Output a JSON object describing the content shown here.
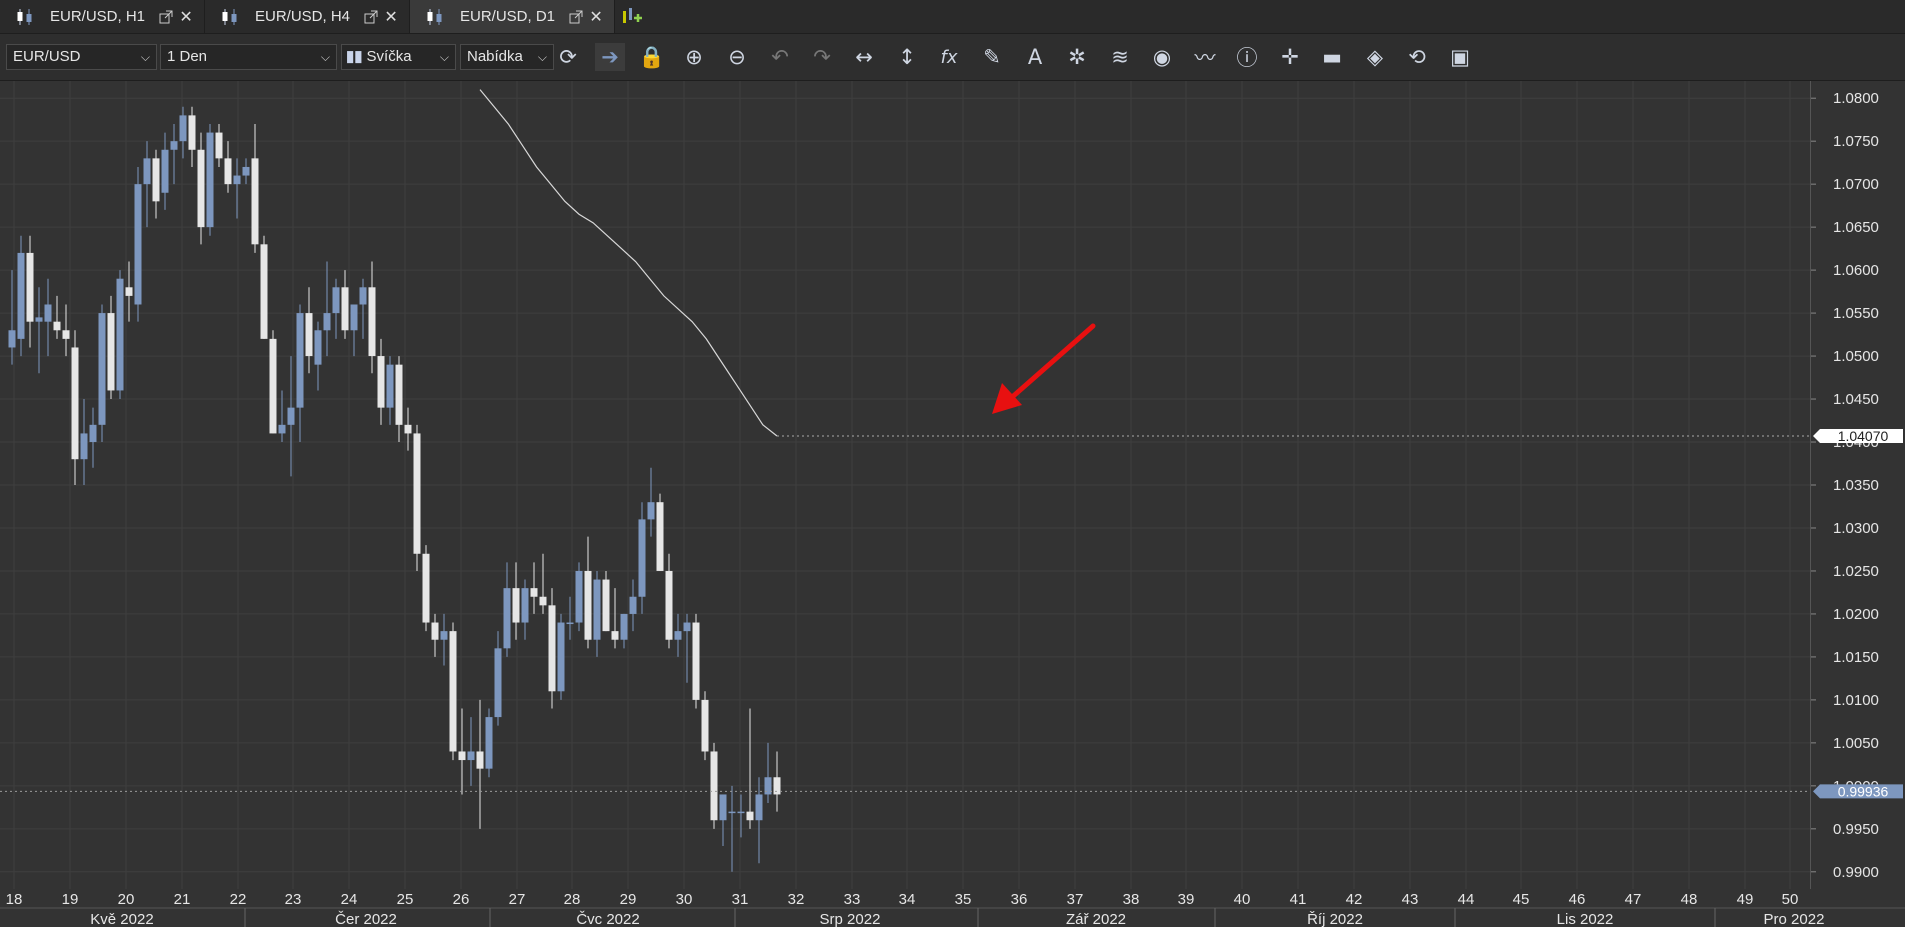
{
  "tabs": [
    {
      "label": "EUR/USD, H1",
      "icon": "candles-icon"
    },
    {
      "label": "EUR/USD, H4",
      "icon": "candles-icon"
    },
    {
      "label": "EUR/USD, D1",
      "icon": "candles-icon",
      "active": true
    }
  ],
  "toolbar": {
    "symbol": "EUR/USD",
    "period": "1 Den",
    "chart_type": "Svíčka",
    "price_type": "Nabídka",
    "icons": [
      "refresh-icon",
      "autoscroll-icon",
      "lock-icon",
      "zoom-in-icon",
      "zoom-out-icon",
      "undo-icon",
      "redo-icon",
      "horizontal-scale-icon",
      "vertical-scale-icon",
      "indicator-fx-icon",
      "pencil-icon",
      "text-tool-icon",
      "objects-icon",
      "layers-icon",
      "eye-icon",
      "signal-icon",
      "info-icon",
      "crosshair-icon",
      "ohlc-color-icon",
      "theme-icon",
      "settings-icon",
      "save-icon"
    ]
  },
  "colors": {
    "background": "#333333",
    "bull": "#7d97bf",
    "bear": "#e6e6e6",
    "grid": "#3f3f3f",
    "arrow": "#e81010",
    "current_price_tag": "#7d97bf"
  },
  "chart_data": {
    "type": "candlestick",
    "ylim": [
      0.988,
      1.082
    ],
    "yticks": [
      "1.0800",
      "1.0750",
      "1.0700",
      "1.0650",
      "1.0600",
      "1.0550",
      "1.0500",
      "1.0450",
      "1.0400",
      "1.0350",
      "1.0300",
      "1.0250",
      "1.0200",
      "1.0150",
      "1.0100",
      "1.0050",
      "1.0000",
      "0.9950",
      "0.9900"
    ],
    "week_labels": [
      "18",
      "19",
      "20",
      "21",
      "22",
      "23",
      "24",
      "25",
      "26",
      "27",
      "28",
      "29",
      "30",
      "31",
      "32",
      "33",
      "34",
      "35",
      "36",
      "37",
      "38",
      "39",
      "40",
      "41",
      "42",
      "43",
      "44",
      "45",
      "46",
      "47",
      "48",
      "49",
      "50"
    ],
    "month_labels": [
      "Kvě 2022",
      "Čer 2022",
      "Čvc 2022",
      "Srp 2022",
      "Zář 2022",
      "Říj 2022",
      "Lis 2022",
      "Pro 2022"
    ],
    "grid": true,
    "indicator_line": {
      "end_value": 1.0407,
      "label": "1.04070",
      "values": [
        1.081,
        1.079,
        1.077,
        1.0745,
        1.072,
        1.07,
        1.068,
        1.0665,
        1.0655,
        1.064,
        1.0625,
        1.061,
        1.059,
        1.057,
        1.0555,
        1.054,
        1.052,
        1.0495,
        1.047,
        1.0445,
        1.042,
        1.0407
      ]
    },
    "current_price": {
      "value": 0.99936,
      "label": "0.99936"
    },
    "candles": [
      {
        "o": 1.051,
        "h": 1.06,
        "l": 1.049,
        "c": 1.053
      },
      {
        "o": 1.052,
        "h": 1.064,
        "l": 1.05,
        "c": 1.062
      },
      {
        "o": 1.062,
        "h": 1.064,
        "l": 1.051,
        "c": 1.054
      },
      {
        "o": 1.054,
        "h": 1.058,
        "l": 1.048,
        "c": 1.0545
      },
      {
        "o": 1.054,
        "h": 1.059,
        "l": 1.05,
        "c": 1.056
      },
      {
        "o": 1.054,
        "h": 1.057,
        "l": 1.052,
        "c": 1.053
      },
      {
        "o": 1.053,
        "h": 1.056,
        "l": 1.05,
        "c": 1.052
      },
      {
        "o": 1.051,
        "h": 1.053,
        "l": 1.035,
        "c": 1.038
      },
      {
        "o": 1.038,
        "h": 1.045,
        "l": 1.035,
        "c": 1.041
      },
      {
        "o": 1.04,
        "h": 1.044,
        "l": 1.037,
        "c": 1.042
      },
      {
        "o": 1.042,
        "h": 1.056,
        "l": 1.04,
        "c": 1.055
      },
      {
        "o": 1.055,
        "h": 1.057,
        "l": 1.045,
        "c": 1.046
      },
      {
        "o": 1.046,
        "h": 1.06,
        "l": 1.045,
        "c": 1.059
      },
      {
        "o": 1.058,
        "h": 1.061,
        "l": 1.054,
        "c": 1.057
      },
      {
        "o": 1.056,
        "h": 1.072,
        "l": 1.054,
        "c": 1.07
      },
      {
        "o": 1.07,
        "h": 1.075,
        "l": 1.065,
        "c": 1.073
      },
      {
        "o": 1.073,
        "h": 1.074,
        "l": 1.066,
        "c": 1.068
      },
      {
        "o": 1.069,
        "h": 1.076,
        "l": 1.067,
        "c": 1.074
      },
      {
        "o": 1.074,
        "h": 1.077,
        "l": 1.07,
        "c": 1.075
      },
      {
        "o": 1.075,
        "h": 1.079,
        "l": 1.073,
        "c": 1.078
      },
      {
        "o": 1.078,
        "h": 1.079,
        "l": 1.072,
        "c": 1.074
      },
      {
        "o": 1.074,
        "h": 1.076,
        "l": 1.063,
        "c": 1.065
      },
      {
        "o": 1.065,
        "h": 1.077,
        "l": 1.064,
        "c": 1.076
      },
      {
        "o": 1.076,
        "h": 1.077,
        "l": 1.072,
        "c": 1.073
      },
      {
        "o": 1.073,
        "h": 1.075,
        "l": 1.069,
        "c": 1.07
      },
      {
        "o": 1.07,
        "h": 1.073,
        "l": 1.066,
        "c": 1.071
      },
      {
        "o": 1.071,
        "h": 1.073,
        "l": 1.07,
        "c": 1.072
      },
      {
        "o": 1.073,
        "h": 1.077,
        "l": 1.062,
        "c": 1.063
      },
      {
        "o": 1.063,
        "h": 1.064,
        "l": 1.052,
        "c": 1.052
      },
      {
        "o": 1.052,
        "h": 1.053,
        "l": 1.041,
        "c": 1.041
      },
      {
        "o": 1.041,
        "h": 1.046,
        "l": 1.04,
        "c": 1.042
      },
      {
        "o": 1.042,
        "h": 1.05,
        "l": 1.036,
        "c": 1.044
      },
      {
        "o": 1.044,
        "h": 1.056,
        "l": 1.04,
        "c": 1.055
      },
      {
        "o": 1.055,
        "h": 1.058,
        "l": 1.048,
        "c": 1.05
      },
      {
        "o": 1.049,
        "h": 1.054,
        "l": 1.046,
        "c": 1.053
      },
      {
        "o": 1.053,
        "h": 1.061,
        "l": 1.05,
        "c": 1.055
      },
      {
        "o": 1.055,
        "h": 1.059,
        "l": 1.052,
        "c": 1.058
      },
      {
        "o": 1.058,
        "h": 1.06,
        "l": 1.052,
        "c": 1.053
      },
      {
        "o": 1.053,
        "h": 1.056,
        "l": 1.05,
        "c": 1.056
      },
      {
        "o": 1.056,
        "h": 1.059,
        "l": 1.052,
        "c": 1.058
      },
      {
        "o": 1.058,
        "h": 1.061,
        "l": 1.048,
        "c": 1.05
      },
      {
        "o": 1.05,
        "h": 1.052,
        "l": 1.042,
        "c": 1.044
      },
      {
        "o": 1.044,
        "h": 1.05,
        "l": 1.042,
        "c": 1.049
      },
      {
        "o": 1.049,
        "h": 1.05,
        "l": 1.04,
        "c": 1.042
      },
      {
        "o": 1.042,
        "h": 1.044,
        "l": 1.039,
        "c": 1.041
      },
      {
        "o": 1.041,
        "h": 1.042,
        "l": 1.025,
        "c": 1.027
      },
      {
        "o": 1.027,
        "h": 1.028,
        "l": 1.018,
        "c": 1.019
      },
      {
        "o": 1.019,
        "h": 1.02,
        "l": 1.015,
        "c": 1.017
      },
      {
        "o": 1.017,
        "h": 1.02,
        "l": 1.014,
        "c": 1.018
      },
      {
        "o": 1.018,
        "h": 1.019,
        "l": 1.003,
        "c": 1.004
      },
      {
        "o": 1.004,
        "h": 1.009,
        "l": 0.999,
        "c": 1.003
      },
      {
        "o": 1.003,
        "h": 1.008,
        "l": 1.0,
        "c": 1.004
      },
      {
        "o": 1.004,
        "h": 1.01,
        "l": 0.995,
        "c": 1.002
      },
      {
        "o": 1.002,
        "h": 1.009,
        "l": 1.001,
        "c": 1.008
      },
      {
        "o": 1.008,
        "h": 1.018,
        "l": 1.007,
        "c": 1.016
      },
      {
        "o": 1.016,
        "h": 1.026,
        "l": 1.015,
        "c": 1.023
      },
      {
        "o": 1.023,
        "h": 1.026,
        "l": 1.017,
        "c": 1.019
      },
      {
        "o": 1.019,
        "h": 1.024,
        "l": 1.017,
        "c": 1.023
      },
      {
        "o": 1.023,
        "h": 1.026,
        "l": 1.02,
        "c": 1.022
      },
      {
        "o": 1.022,
        "h": 1.027,
        "l": 1.02,
        "c": 1.021
      },
      {
        "o": 1.021,
        "h": 1.023,
        "l": 1.009,
        "c": 1.011
      },
      {
        "o": 1.011,
        "h": 1.02,
        "l": 1.01,
        "c": 1.019
      },
      {
        "o": 1.019,
        "h": 1.022,
        "l": 1.017,
        "c": 1.019
      },
      {
        "o": 1.019,
        "h": 1.026,
        "l": 1.018,
        "c": 1.025
      },
      {
        "o": 1.025,
        "h": 1.029,
        "l": 1.016,
        "c": 1.017
      },
      {
        "o": 1.017,
        "h": 1.025,
        "l": 1.015,
        "c": 1.024
      },
      {
        "o": 1.024,
        "h": 1.025,
        "l": 1.018,
        "c": 1.018
      },
      {
        "o": 1.018,
        "h": 1.023,
        "l": 1.016,
        "c": 1.017
      },
      {
        "o": 1.017,
        "h": 1.02,
        "l": 1.016,
        "c": 1.02
      },
      {
        "o": 1.02,
        "h": 1.024,
        "l": 1.018,
        "c": 1.022
      },
      {
        "o": 1.022,
        "h": 1.033,
        "l": 1.02,
        "c": 1.031
      },
      {
        "o": 1.031,
        "h": 1.037,
        "l": 1.029,
        "c": 1.033
      },
      {
        "o": 1.033,
        "h": 1.034,
        "l": 1.025,
        "c": 1.025
      },
      {
        "o": 1.025,
        "h": 1.027,
        "l": 1.016,
        "c": 1.017
      },
      {
        "o": 1.017,
        "h": 1.02,
        "l": 1.015,
        "c": 1.018
      },
      {
        "o": 1.018,
        "h": 1.02,
        "l": 1.012,
        "c": 1.019
      },
      {
        "o": 1.019,
        "h": 1.02,
        "l": 1.009,
        "c": 1.01
      },
      {
        "o": 1.01,
        "h": 1.011,
        "l": 1.003,
        "c": 1.004
      },
      {
        "o": 1.004,
        "h": 1.005,
        "l": 0.995,
        "c": 0.996
      },
      {
        "o": 0.996,
        "h": 0.999,
        "l": 0.993,
        "c": 0.999
      },
      {
        "o": 0.997,
        "h": 1.0,
        "l": 0.99,
        "c": 0.997
      },
      {
        "o": 0.997,
        "h": 0.999,
        "l": 0.994,
        "c": 0.997
      },
      {
        "o": 0.997,
        "h": 1.009,
        "l": 0.995,
        "c": 0.996
      },
      {
        "o": 0.996,
        "h": 1.001,
        "l": 0.991,
        "c": 0.999
      },
      {
        "o": 0.999,
        "h": 1.005,
        "l": 0.998,
        "c": 1.001
      },
      {
        "o": 1.001,
        "h": 1.004,
        "l": 0.997,
        "c": 0.999
      }
    ]
  }
}
